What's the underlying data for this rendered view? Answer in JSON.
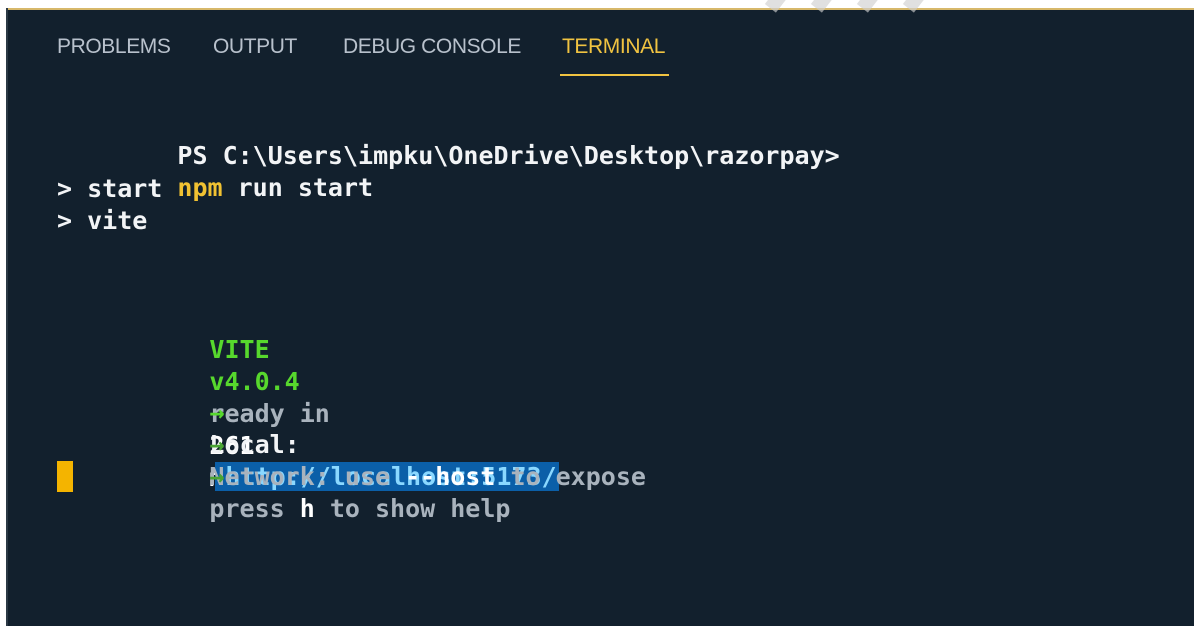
{
  "tabs": [
    {
      "label": "PROBLEMS"
    },
    {
      "label": "OUTPUT"
    },
    {
      "label": "DEBUG CONSOLE"
    },
    {
      "label": "TERMINAL"
    }
  ],
  "active_tab": "TERMINAL",
  "terminal": {
    "prompt": "PS C:\\Users\\impku\\OneDrive\\Desktop\\razorpay>",
    "command_program": "npm",
    "command_args": " run start",
    "script_lines": [
      "> start",
      "> vite"
    ],
    "vite_name": "VITE",
    "vite_version": "v4.0.4",
    "ready_text": "ready in",
    "ready_time": "261",
    "ready_unit": "ms",
    "arrow": "→",
    "local_label": "Local:",
    "local_url": "http://localhost:5173/",
    "network_label": "Network",
    "network_text": ": use ",
    "host_flag": "--host",
    "expose_text": " to expose",
    "help_text_prefix": "press ",
    "help_key": "h",
    "help_text_suffix": " to show help"
  },
  "colors": {
    "background": "#12202d",
    "active_tab": "#f0c341",
    "vite_green": "#57d82d",
    "link_background": "#0b5fa8",
    "cursor": "#f4b400"
  }
}
